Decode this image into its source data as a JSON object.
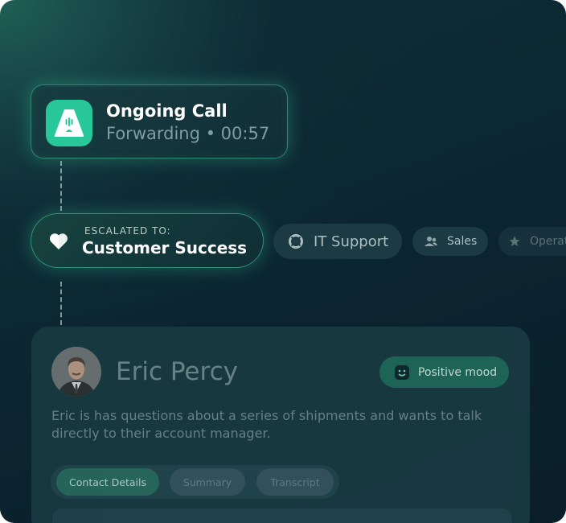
{
  "call": {
    "title": "Ongoing Call",
    "status": "Forwarding • 00:57"
  },
  "escalation": {
    "label": "ESCALATED TO:",
    "team": "Customer Success"
  },
  "teams": [
    {
      "label": "IT Support",
      "icon": "lifebuoy-icon"
    },
    {
      "label": "Sales",
      "icon": "users-icon"
    },
    {
      "label": "Operations",
      "icon": "star-icon"
    }
  ],
  "contact": {
    "name": "Eric Percy",
    "mood": "Positive mood",
    "description": "Eric is has questions about a series of shipments and wants to talk directly to their account manager.",
    "tabs": [
      {
        "label": "Contact Details",
        "active": true
      },
      {
        "label": "Summary",
        "active": false
      },
      {
        "label": "Transcript",
        "active": false
      }
    ]
  },
  "colors": {
    "accent": "#27c79a",
    "glow": "#48c8a0",
    "background": "#0c2530"
  }
}
